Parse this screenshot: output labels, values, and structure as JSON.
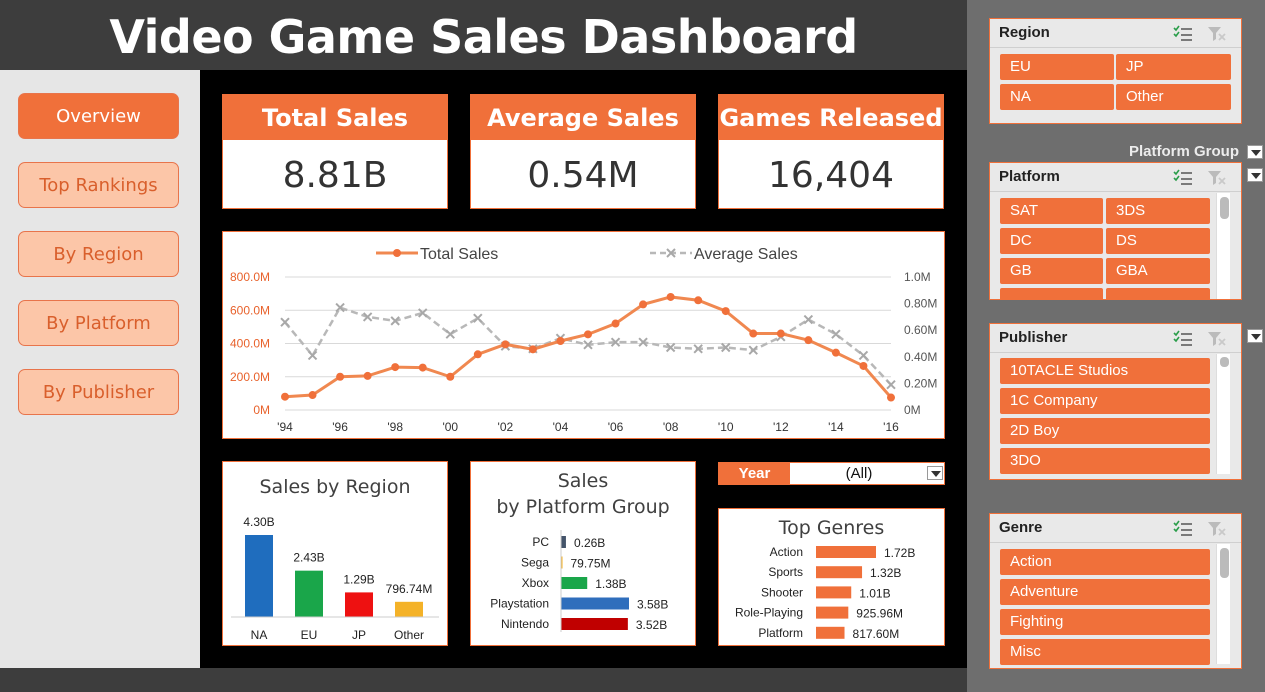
{
  "header": {
    "title": "Video Game Sales Dashboard"
  },
  "nav": [
    {
      "label": "Overview",
      "active": true
    },
    {
      "label": "Top Rankings"
    },
    {
      "label": "By Region"
    },
    {
      "label": "By Platform"
    },
    {
      "label": "By Publisher"
    }
  ],
  "kpis": {
    "total_sales": {
      "label": "Total Sales",
      "value": "8.81B"
    },
    "average_sales": {
      "label": "Average Sales",
      "value": "0.54M"
    },
    "games_released": {
      "label": "Games Released",
      "value": "16,404"
    }
  },
  "colors": {
    "accent": "#f0703a",
    "accent_light": "#fcc6a8",
    "na": "#1f6dbe",
    "eu": "#1aa64a",
    "jp": "#ee1111",
    "other": "#f4b228",
    "nintendo": "#c00000",
    "playstation": "#2f6ebc",
    "xbox": "#1aa64a",
    "sega": "#f4b228",
    "pc": "#44546a"
  },
  "year_filter": {
    "label": "Year",
    "value": "(All)"
  },
  "chart_data": [
    {
      "type": "line",
      "legend": [
        "Total Sales",
        "Average Sales"
      ],
      "x": [
        "'94",
        "'95",
        "'96",
        "'97",
        "'98",
        "'99",
        "'00",
        "'01",
        "'02",
        "'03",
        "'04",
        "'05",
        "'06",
        "'07",
        "'08",
        "'09",
        "'10",
        "'11",
        "'12",
        "'13",
        "'14",
        "'15",
        "'16"
      ],
      "x_tick_labels": [
        "'94",
        "'96",
        "'98",
        "'00",
        "'02",
        "'04",
        "'06",
        "'08",
        "'10",
        "'12",
        "'14",
        "'16"
      ],
      "series": [
        {
          "name": "Total Sales",
          "axis": "left",
          "color": "#f0703a",
          "style": "solid-dot",
          "values": [
            80,
            90,
            200,
            205,
            258,
            255,
            200,
            335,
            395,
            365,
            415,
            455,
            520,
            635,
            680,
            660,
            595,
            460,
            460,
            420,
            345,
            265,
            75
          ]
        },
        {
          "name": "Average Sales",
          "axis": "right",
          "color": "#b0b0b0",
          "style": "dashed-x",
          "values": [
            0.66,
            0.41,
            0.77,
            0.7,
            0.67,
            0.73,
            0.57,
            0.69,
            0.48,
            0.46,
            0.54,
            0.49,
            0.51,
            0.51,
            0.47,
            0.46,
            0.47,
            0.45,
            0.55,
            0.68,
            0.57,
            0.41,
            0.19
          ]
        }
      ],
      "y_left": {
        "ticks": [
          "0M",
          "200.0M",
          "400.0M",
          "600.0M",
          "800.0M"
        ],
        "range": [
          0,
          800
        ]
      },
      "y_right": {
        "ticks": [
          "0M",
          "0.20M",
          "0.40M",
          "0.60M",
          "0.80M",
          "1.0M"
        ],
        "range": [
          0,
          1.0
        ]
      },
      "grid": true
    },
    {
      "type": "bar",
      "title": "Sales by Region",
      "categories": [
        "NA",
        "EU",
        "JP",
        "Other"
      ],
      "values": [
        4.3,
        2.43,
        1.29,
        0.79674
      ],
      "labels": [
        "4.30B",
        "2.43B",
        "1.29B",
        "796.74M"
      ]
    },
    {
      "type": "bar",
      "orientation": "horizontal",
      "title": "Sales by Platform Group",
      "categories": [
        "PC",
        "Sega",
        "Xbox",
        "Playstation",
        "Nintendo"
      ],
      "values": [
        0.26,
        0.07975,
        1.38,
        3.58,
        3.52
      ],
      "labels": [
        "0.26B",
        "79.75M",
        "1.38B",
        "3.58B",
        "3.52B"
      ]
    },
    {
      "type": "bar",
      "orientation": "horizontal",
      "title": "Top Genres",
      "categories": [
        "Action",
        "Sports",
        "Shooter",
        "Role-Playing",
        "Platform"
      ],
      "values": [
        1.72,
        1.32,
        1.01,
        0.92596,
        0.8176
      ],
      "labels": [
        "1.72B",
        "1.32B",
        "1.01B",
        "925.96M",
        "817.60M"
      ]
    }
  ],
  "slicers": {
    "region": {
      "title": "Region",
      "items": [
        "EU",
        "JP",
        "NA",
        "Other"
      ]
    },
    "platform_group": {
      "label": "Platform Group"
    },
    "platform": {
      "title": "Platform",
      "items": [
        "SAT",
        "3DS",
        "DC",
        "DS",
        "GB",
        "GBA"
      ]
    },
    "publisher": {
      "title": "Publisher",
      "items": [
        "10TACLE Studios",
        "1C Company",
        "2D Boy",
        "3DO"
      ]
    },
    "genre": {
      "title": "Genre",
      "items": [
        "Action",
        "Adventure",
        "Fighting",
        "Misc"
      ]
    }
  }
}
